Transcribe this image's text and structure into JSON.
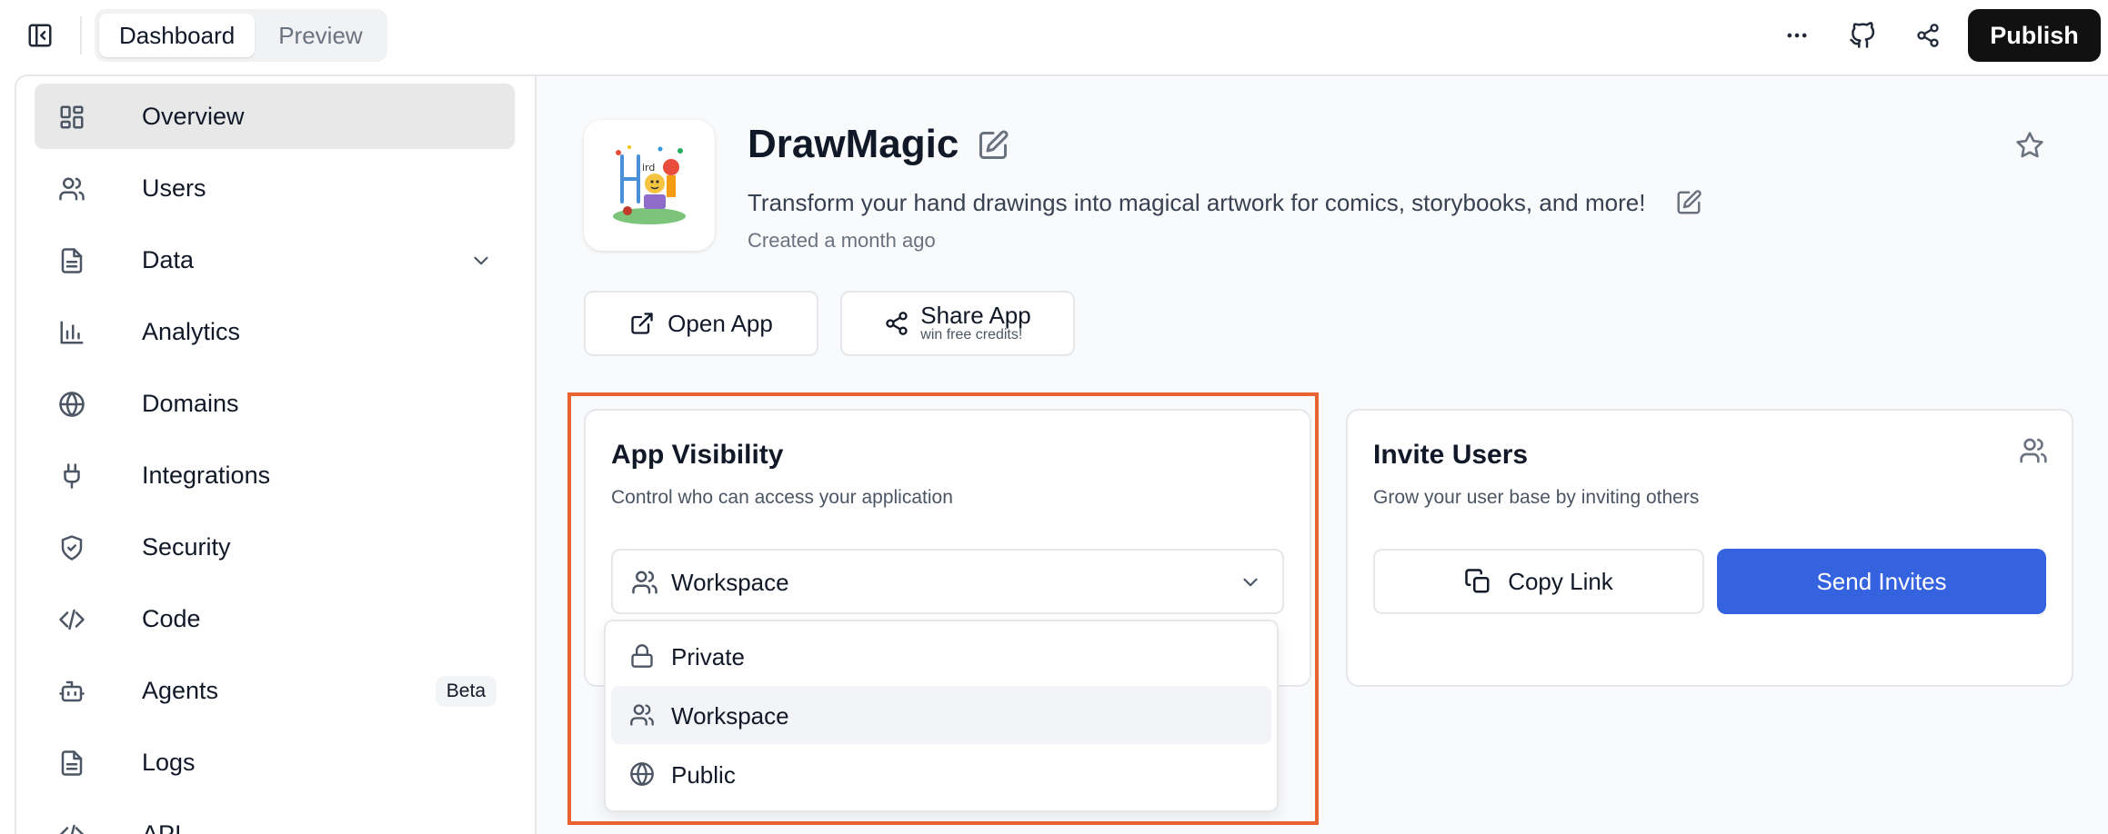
{
  "topbar": {
    "tabs": [
      {
        "label": "Dashboard",
        "active": true
      },
      {
        "label": "Preview",
        "active": false
      }
    ],
    "publish_label": "Publish",
    "icons": [
      "sidebar-collapse-icon",
      "more-icon",
      "github-icon",
      "share-icon"
    ]
  },
  "sidebar": {
    "items": [
      {
        "label": "Overview",
        "icon": "grid-icon",
        "active": true
      },
      {
        "label": "Users",
        "icon": "users-icon"
      },
      {
        "label": "Data",
        "icon": "document-icon",
        "expandable": true
      },
      {
        "label": "Analytics",
        "icon": "bar-chart-icon"
      },
      {
        "label": "Domains",
        "icon": "globe-icon"
      },
      {
        "label": "Integrations",
        "icon": "plug-icon"
      },
      {
        "label": "Security",
        "icon": "shield-icon"
      },
      {
        "label": "Code",
        "icon": "code-icon"
      },
      {
        "label": "Agents",
        "icon": "bot-icon",
        "badge": "Beta"
      },
      {
        "label": "Logs",
        "icon": "document-icon"
      },
      {
        "label": "API",
        "icon": "code-icon"
      }
    ]
  },
  "app": {
    "title": "DrawMagic",
    "description": "Transform your hand drawings into magical artwork for comics, storybooks, and more!",
    "created": "Created a month ago",
    "open_label": "Open App",
    "share_label": "Share App",
    "share_sub": "win free credits!"
  },
  "visibility": {
    "title": "App Visibility",
    "subtitle": "Control who can access your application",
    "selected": "Workspace",
    "options": [
      {
        "label": "Private",
        "icon": "lock-icon"
      },
      {
        "label": "Workspace",
        "icon": "users-icon",
        "highlighted": true
      },
      {
        "label": "Public",
        "icon": "globe-icon"
      }
    ]
  },
  "invite": {
    "title": "Invite Users",
    "subtitle": "Grow your user base by inviting others",
    "copy_label": "Copy Link",
    "send_label": "Send Invites"
  },
  "colors": {
    "accent_blue": "#3563e0",
    "publish_bg": "#111111",
    "highlight_border": "#e8632f"
  }
}
